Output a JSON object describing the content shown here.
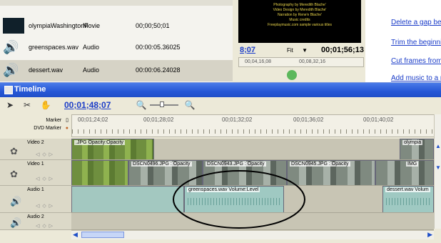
{
  "project": {
    "rows": [
      {
        "name": "olympiaWashingtonF",
        "type": "Movie",
        "duration": "00;00;50;01"
      },
      {
        "name": "greenspaces.wav",
        "type": "Audio",
        "duration": "00:00:05.36025"
      },
      {
        "name": "dessert.wav",
        "type": "Audio",
        "duration": "00:00:06.24028"
      }
    ]
  },
  "monitor": {
    "credits": [
      "Photography by Meredith Blache'",
      "Video Design by Meredith Blache'",
      "Narration by Rene'e Blache'",
      "Music credits",
      "Freeplaymusic.com sample various titles"
    ],
    "current_time": "8;07",
    "fit_label": "Fit",
    "duration": "00;01;56;13",
    "mini_ruler": [
      "00,04,16,08",
      "00,08,32,16"
    ]
  },
  "tasks": {
    "links": [
      "Delete a gap bet",
      "Trim the beginni",
      "Cut frames from",
      "Add music to a n"
    ]
  },
  "timeline": {
    "title": "Timeline",
    "timecode": "00;01;48;07",
    "ruler_marks": [
      "00;01;24;02",
      "00;01;28;02",
      "00;01;32;02",
      "00;01;36;02",
      "00;01;40;02"
    ],
    "marker_label": "Marker",
    "dvd_marker_label": "DVD Marker",
    "tracks": {
      "video2": "Video 2",
      "video1": "Video 1",
      "audio1": "Audio 1",
      "audio2": "Audio 2"
    },
    "clips": {
      "v2_clip": ".JPG Opacity:Opacity",
      "v2_right": "olympia",
      "v1_a": "DSCN0496.JPG : Opacity",
      "v1_b": "DSCN0943.JPG : Opacity",
      "v1_c": "DSCN0945.JPG : Opacity",
      "v1_d": "IMG",
      "a1_green": "greenspaces.wav Volume:Level",
      "a1_dessert": "dessert.wav Volum"
    }
  },
  "colors": {
    "title_bar": "#2557d6",
    "link": "#1a3cc8",
    "timecode": "#1a3cc8"
  }
}
